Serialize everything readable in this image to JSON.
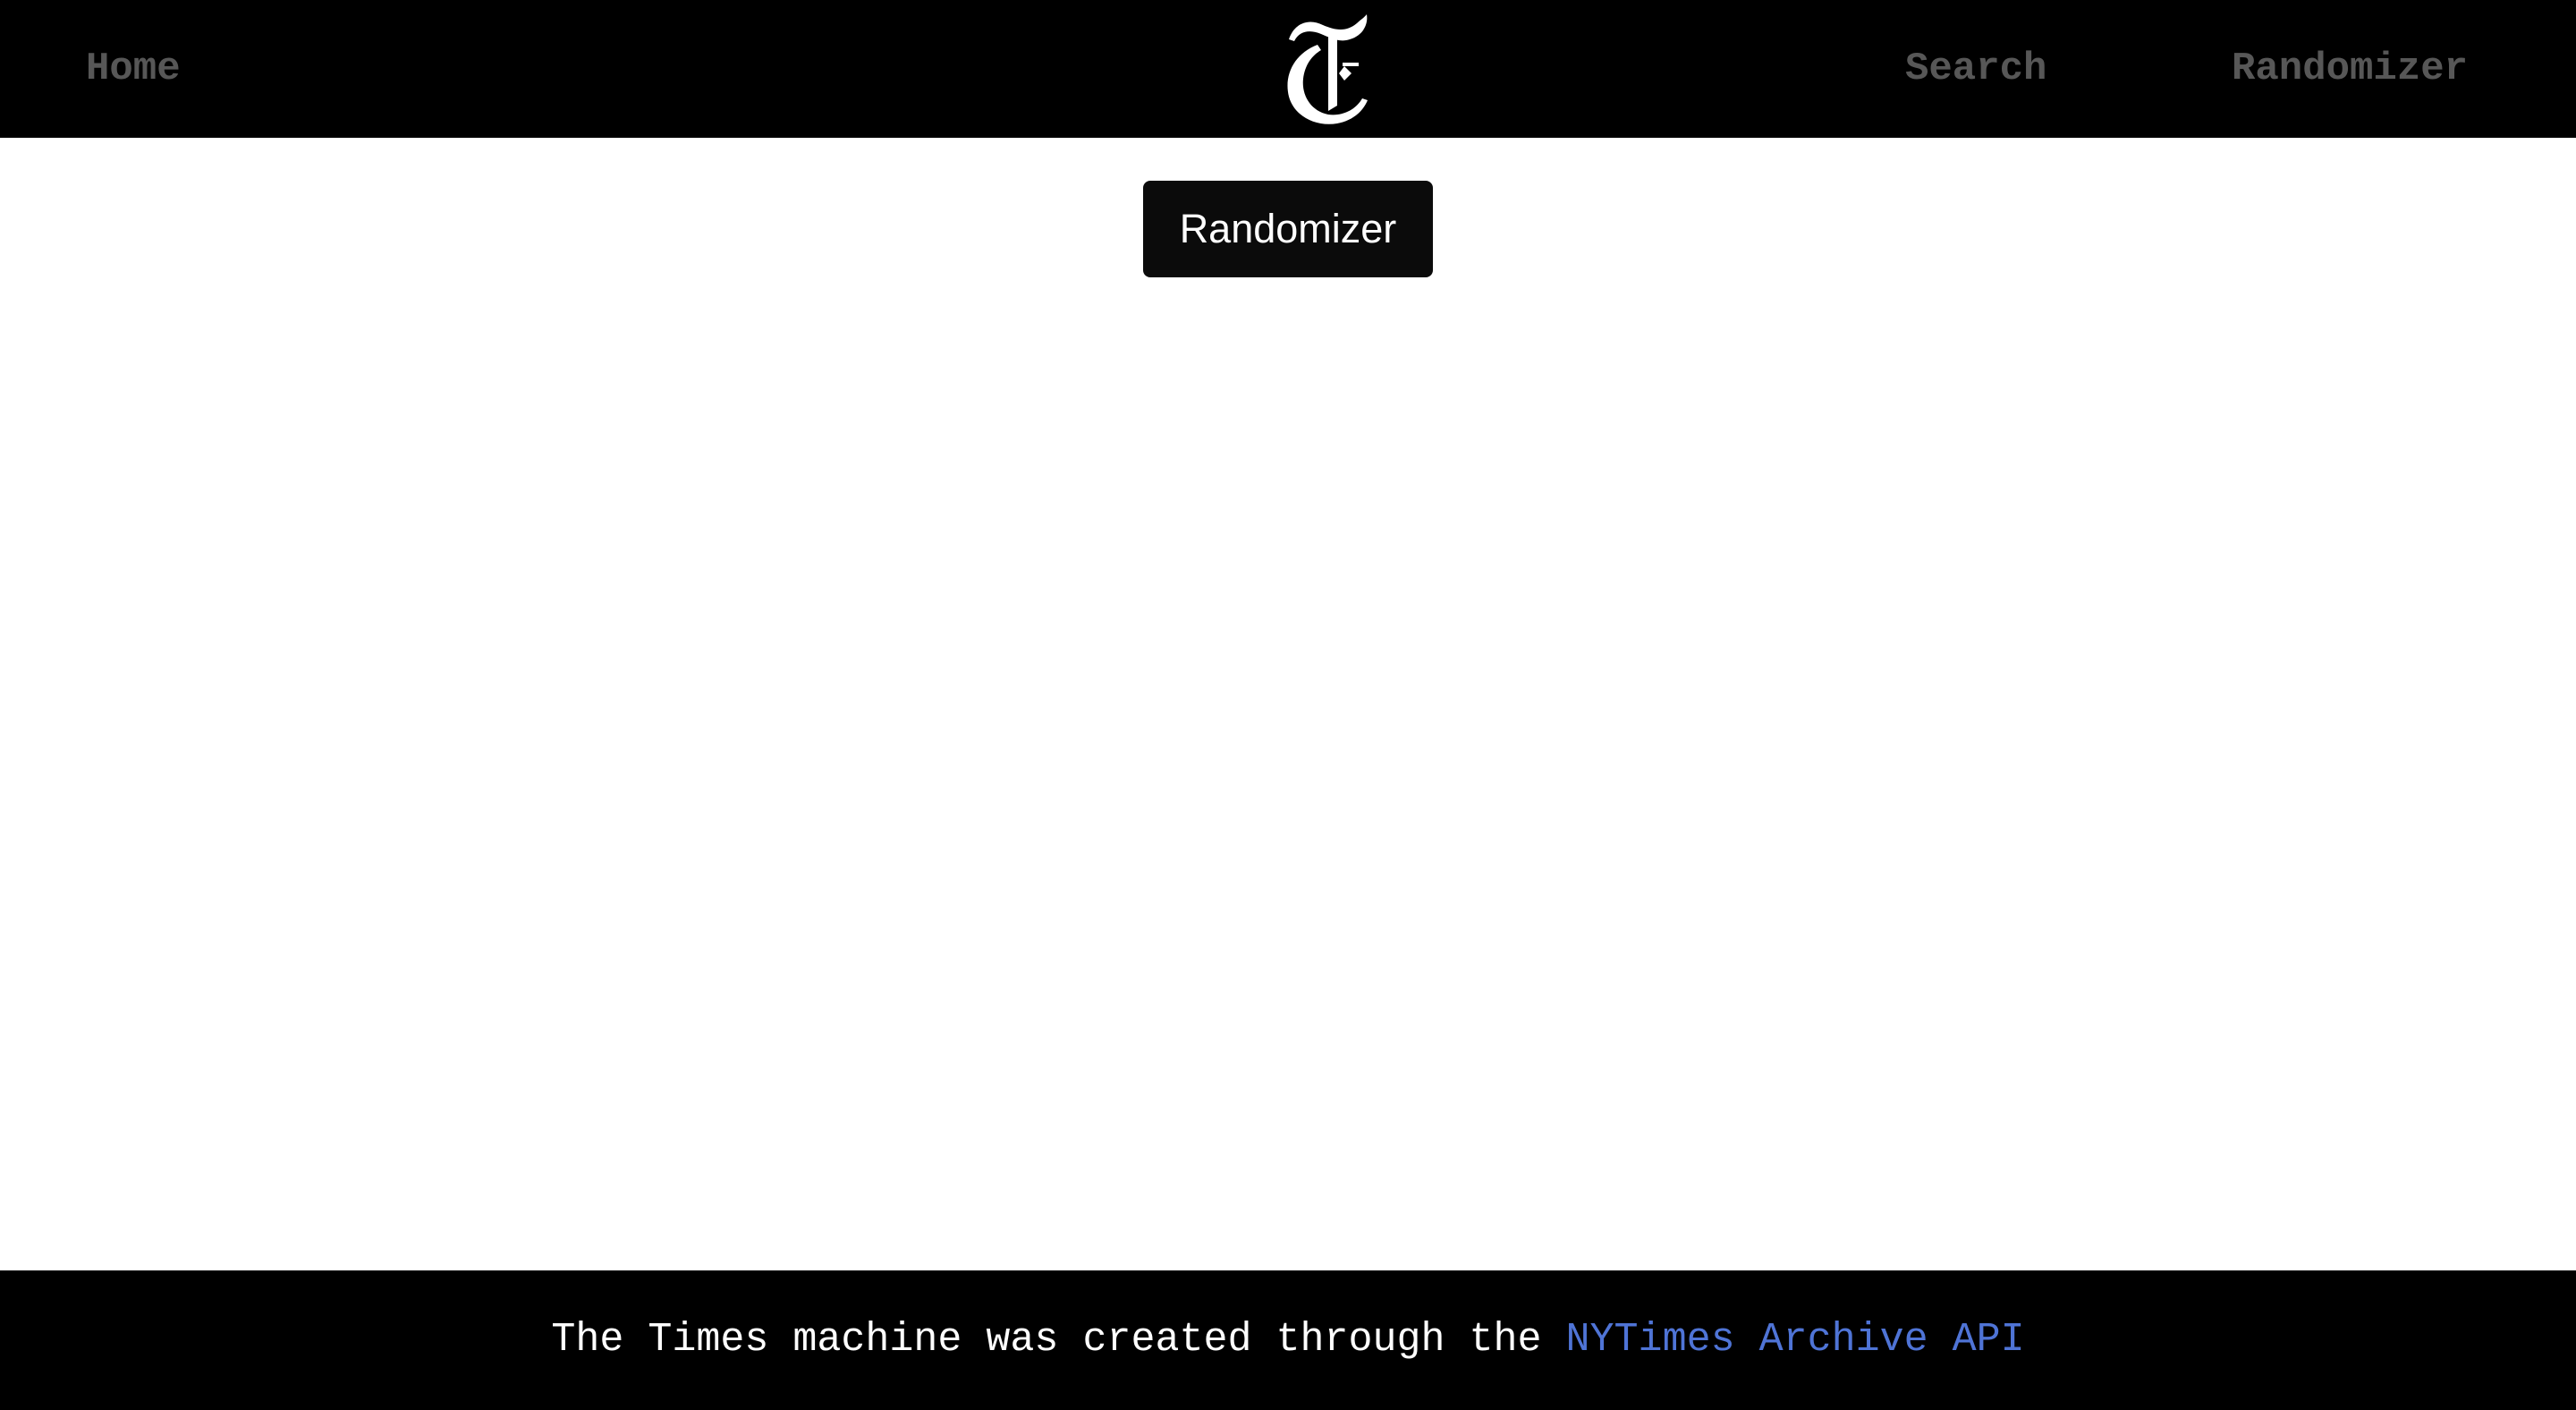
{
  "nav": {
    "home_label": "Home",
    "search_label": "Search",
    "randomizer_label": "Randomizer",
    "logo_icon": "nyt-t-logo-icon"
  },
  "main": {
    "randomizer_button_label": "Randomizer"
  },
  "footer": {
    "text": "The Times machine was created through the",
    "link_label": "NYTimes Archive API"
  },
  "colors": {
    "nav_background": "#000000",
    "nav_link": "#575757",
    "button_background": "#0b0b0b",
    "footer_link": "#4f74d6"
  }
}
